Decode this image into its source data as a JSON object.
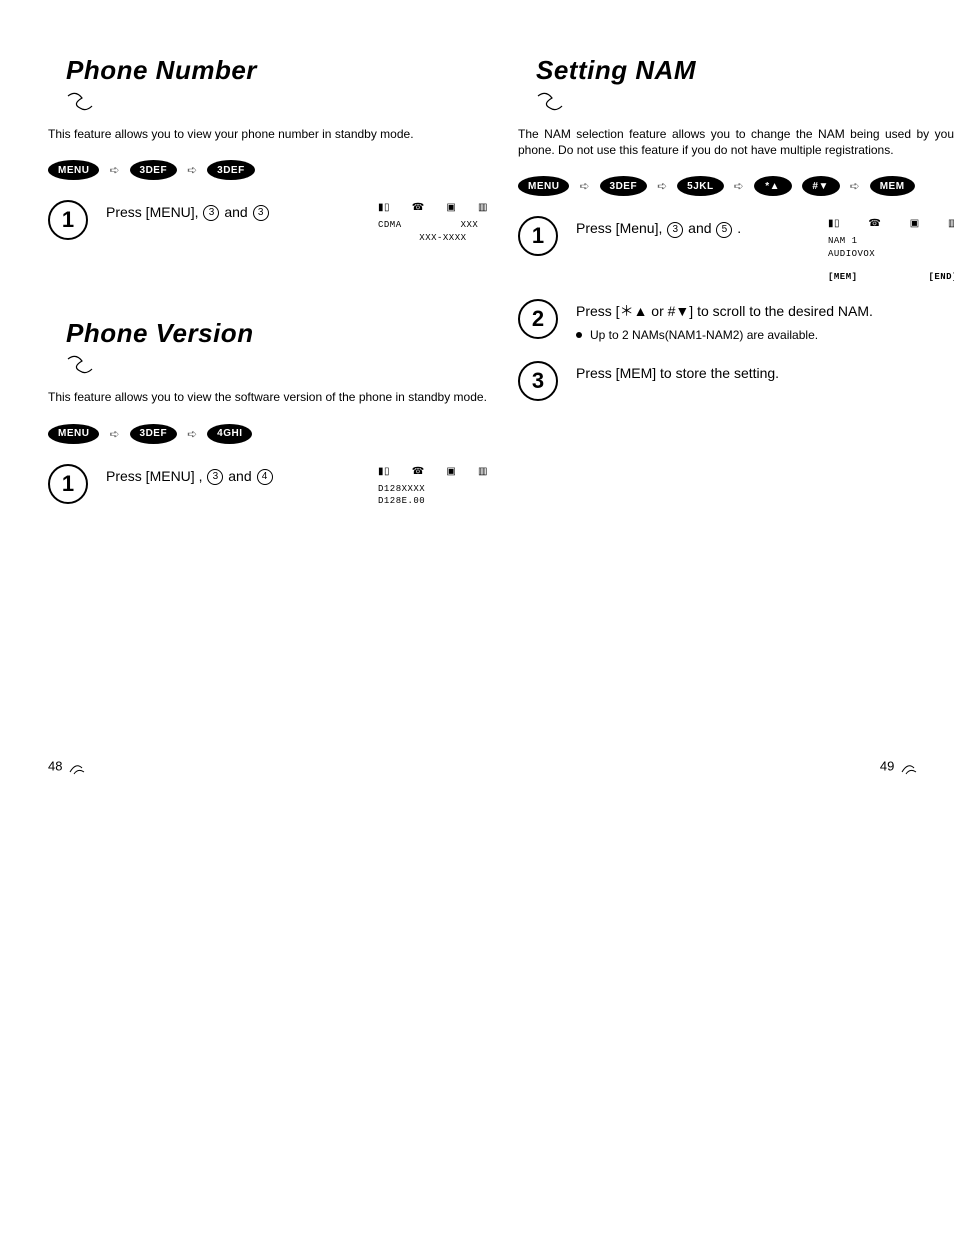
{
  "left": {
    "sec1": {
      "title": "Phone Number",
      "desc": "This feature allows you to view your phone number in standby mode.",
      "keys": [
        "MENU",
        "3DEF",
        "3DEF"
      ],
      "step1_a": "Press [MENU], ",
      "step1_b": " and ",
      "step1_k1": "3",
      "step1_k2": "3",
      "screen": {
        "l1": "CDMA          XXX",
        "l2": "       XXX-XXXX"
      }
    },
    "sec2": {
      "title": "Phone Version",
      "desc": "This feature allows you to view the software version of the phone in standby mode.",
      "keys": [
        "MENU",
        "3DEF",
        "4GHI"
      ],
      "step1_a": "Press [MENU] , ",
      "step1_b": " and ",
      "step1_k1": "3",
      "step1_k2": "4",
      "screen": {
        "l1": "D128XXXX",
        "l2": "D128E.00"
      }
    },
    "page": "48"
  },
  "right": {
    "sec1": {
      "title": "Setting NAM",
      "desc": "The NAM selection feature allows you to change the NAM being used by your phone. Do not use this feature if you do not have multiple registrations.",
      "keys": [
        "MENU",
        "3DEF",
        "5JKL",
        "*▲",
        "#▼",
        "MEM"
      ],
      "step1_a": "Press [Menu], ",
      "step1_b": " and ",
      "step1_c": " .",
      "step1_k1": "3",
      "step1_k2": "5",
      "step2": "Press [＊▲ or #▼] to scroll to the desired NAM.",
      "step2_note": "Up to 2 NAMs(NAM1-NAM2) are available.",
      "step3": "Press [MEM] to store the setting.",
      "screen": {
        "l1": "NAM 1",
        "l2": "AUDIOVOX",
        "b1": "[MEM]",
        "b2": "[END]"
      }
    },
    "page": "49"
  },
  "icons": {
    "signal": "▮▯",
    "phone": "☎",
    "msg": "▣",
    "batt": "▥"
  }
}
